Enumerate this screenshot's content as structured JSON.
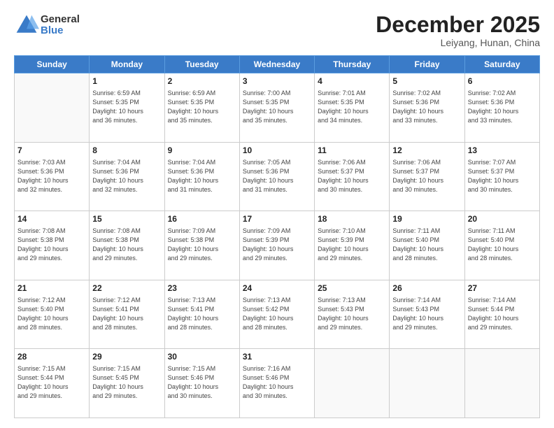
{
  "header": {
    "logo_general": "General",
    "logo_blue": "Blue",
    "month_title": "December 2025",
    "location": "Leiyang, Hunan, China"
  },
  "weekdays": [
    "Sunday",
    "Monday",
    "Tuesday",
    "Wednesday",
    "Thursday",
    "Friday",
    "Saturday"
  ],
  "weeks": [
    [
      {
        "day": "",
        "info": ""
      },
      {
        "day": "1",
        "info": "Sunrise: 6:59 AM\nSunset: 5:35 PM\nDaylight: 10 hours\nand 36 minutes."
      },
      {
        "day": "2",
        "info": "Sunrise: 6:59 AM\nSunset: 5:35 PM\nDaylight: 10 hours\nand 35 minutes."
      },
      {
        "day": "3",
        "info": "Sunrise: 7:00 AM\nSunset: 5:35 PM\nDaylight: 10 hours\nand 35 minutes."
      },
      {
        "day": "4",
        "info": "Sunrise: 7:01 AM\nSunset: 5:35 PM\nDaylight: 10 hours\nand 34 minutes."
      },
      {
        "day": "5",
        "info": "Sunrise: 7:02 AM\nSunset: 5:36 PM\nDaylight: 10 hours\nand 33 minutes."
      },
      {
        "day": "6",
        "info": "Sunrise: 7:02 AM\nSunset: 5:36 PM\nDaylight: 10 hours\nand 33 minutes."
      }
    ],
    [
      {
        "day": "7",
        "info": "Sunrise: 7:03 AM\nSunset: 5:36 PM\nDaylight: 10 hours\nand 32 minutes."
      },
      {
        "day": "8",
        "info": "Sunrise: 7:04 AM\nSunset: 5:36 PM\nDaylight: 10 hours\nand 32 minutes."
      },
      {
        "day": "9",
        "info": "Sunrise: 7:04 AM\nSunset: 5:36 PM\nDaylight: 10 hours\nand 31 minutes."
      },
      {
        "day": "10",
        "info": "Sunrise: 7:05 AM\nSunset: 5:36 PM\nDaylight: 10 hours\nand 31 minutes."
      },
      {
        "day": "11",
        "info": "Sunrise: 7:06 AM\nSunset: 5:37 PM\nDaylight: 10 hours\nand 30 minutes."
      },
      {
        "day": "12",
        "info": "Sunrise: 7:06 AM\nSunset: 5:37 PM\nDaylight: 10 hours\nand 30 minutes."
      },
      {
        "day": "13",
        "info": "Sunrise: 7:07 AM\nSunset: 5:37 PM\nDaylight: 10 hours\nand 30 minutes."
      }
    ],
    [
      {
        "day": "14",
        "info": "Sunrise: 7:08 AM\nSunset: 5:38 PM\nDaylight: 10 hours\nand 29 minutes."
      },
      {
        "day": "15",
        "info": "Sunrise: 7:08 AM\nSunset: 5:38 PM\nDaylight: 10 hours\nand 29 minutes."
      },
      {
        "day": "16",
        "info": "Sunrise: 7:09 AM\nSunset: 5:38 PM\nDaylight: 10 hours\nand 29 minutes."
      },
      {
        "day": "17",
        "info": "Sunrise: 7:09 AM\nSunset: 5:39 PM\nDaylight: 10 hours\nand 29 minutes."
      },
      {
        "day": "18",
        "info": "Sunrise: 7:10 AM\nSunset: 5:39 PM\nDaylight: 10 hours\nand 29 minutes."
      },
      {
        "day": "19",
        "info": "Sunrise: 7:11 AM\nSunset: 5:40 PM\nDaylight: 10 hours\nand 28 minutes."
      },
      {
        "day": "20",
        "info": "Sunrise: 7:11 AM\nSunset: 5:40 PM\nDaylight: 10 hours\nand 28 minutes."
      }
    ],
    [
      {
        "day": "21",
        "info": "Sunrise: 7:12 AM\nSunset: 5:40 PM\nDaylight: 10 hours\nand 28 minutes."
      },
      {
        "day": "22",
        "info": "Sunrise: 7:12 AM\nSunset: 5:41 PM\nDaylight: 10 hours\nand 28 minutes."
      },
      {
        "day": "23",
        "info": "Sunrise: 7:13 AM\nSunset: 5:41 PM\nDaylight: 10 hours\nand 28 minutes."
      },
      {
        "day": "24",
        "info": "Sunrise: 7:13 AM\nSunset: 5:42 PM\nDaylight: 10 hours\nand 28 minutes."
      },
      {
        "day": "25",
        "info": "Sunrise: 7:13 AM\nSunset: 5:43 PM\nDaylight: 10 hours\nand 29 minutes."
      },
      {
        "day": "26",
        "info": "Sunrise: 7:14 AM\nSunset: 5:43 PM\nDaylight: 10 hours\nand 29 minutes."
      },
      {
        "day": "27",
        "info": "Sunrise: 7:14 AM\nSunset: 5:44 PM\nDaylight: 10 hours\nand 29 minutes."
      }
    ],
    [
      {
        "day": "28",
        "info": "Sunrise: 7:15 AM\nSunset: 5:44 PM\nDaylight: 10 hours\nand 29 minutes."
      },
      {
        "day": "29",
        "info": "Sunrise: 7:15 AM\nSunset: 5:45 PM\nDaylight: 10 hours\nand 29 minutes."
      },
      {
        "day": "30",
        "info": "Sunrise: 7:15 AM\nSunset: 5:46 PM\nDaylight: 10 hours\nand 30 minutes."
      },
      {
        "day": "31",
        "info": "Sunrise: 7:16 AM\nSunset: 5:46 PM\nDaylight: 10 hours\nand 30 minutes."
      },
      {
        "day": "",
        "info": ""
      },
      {
        "day": "",
        "info": ""
      },
      {
        "day": "",
        "info": ""
      }
    ]
  ]
}
